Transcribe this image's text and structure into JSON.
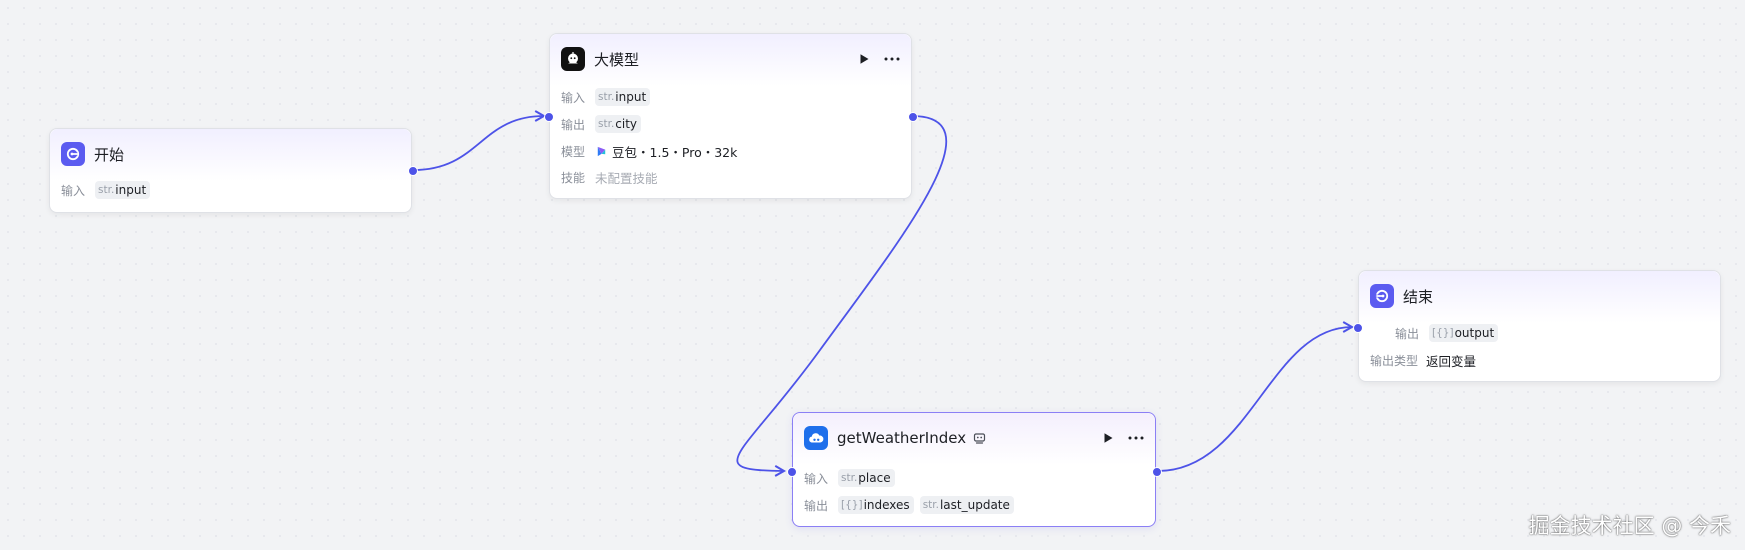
{
  "nodes": {
    "start": {
      "title": "开始",
      "input_label": "输入",
      "input_var": {
        "type": "str.",
        "name": "input"
      }
    },
    "llm": {
      "title": "大模型",
      "input_label": "输入",
      "input_var": {
        "type": "str.",
        "name": "input"
      },
      "output_label": "输出",
      "output_var": {
        "type": "str.",
        "name": "city"
      },
      "model_label": "模型",
      "model_value": "豆包・1.5・Pro・32k",
      "skill_label": "技能",
      "skill_value": "未配置技能"
    },
    "plugin": {
      "title": "getWeatherIndex",
      "input_label": "输入",
      "input_var": {
        "type": "str.",
        "name": "place"
      },
      "output_label": "输出",
      "output_vars": [
        {
          "type": "[{}]",
          "name": "indexes"
        },
        {
          "type": "str.",
          "name": "last_update"
        }
      ]
    },
    "end": {
      "title": "结束",
      "output_label": "输出",
      "output_var": {
        "type": "[{}]",
        "name": "output"
      },
      "output_type_label": "输出类型",
      "output_type_value": "返回变量"
    }
  },
  "icons": {
    "start": "start-icon",
    "llm": "llm-robot-icon",
    "plugin": "weather-plugin-icon",
    "end": "end-icon",
    "run": "play-icon",
    "more": "more-dots-icon"
  },
  "colors": {
    "accent": "#4d53e8",
    "edge": "#4d53e8",
    "start_icon_bg": "#5b5bf0",
    "end_icon_bg": "#5b5bf0",
    "llm_icon_bg": "#111111",
    "plugin_icon_bg": "#1f6feb"
  },
  "watermark": "掘金技术社区 @ 今禾"
}
